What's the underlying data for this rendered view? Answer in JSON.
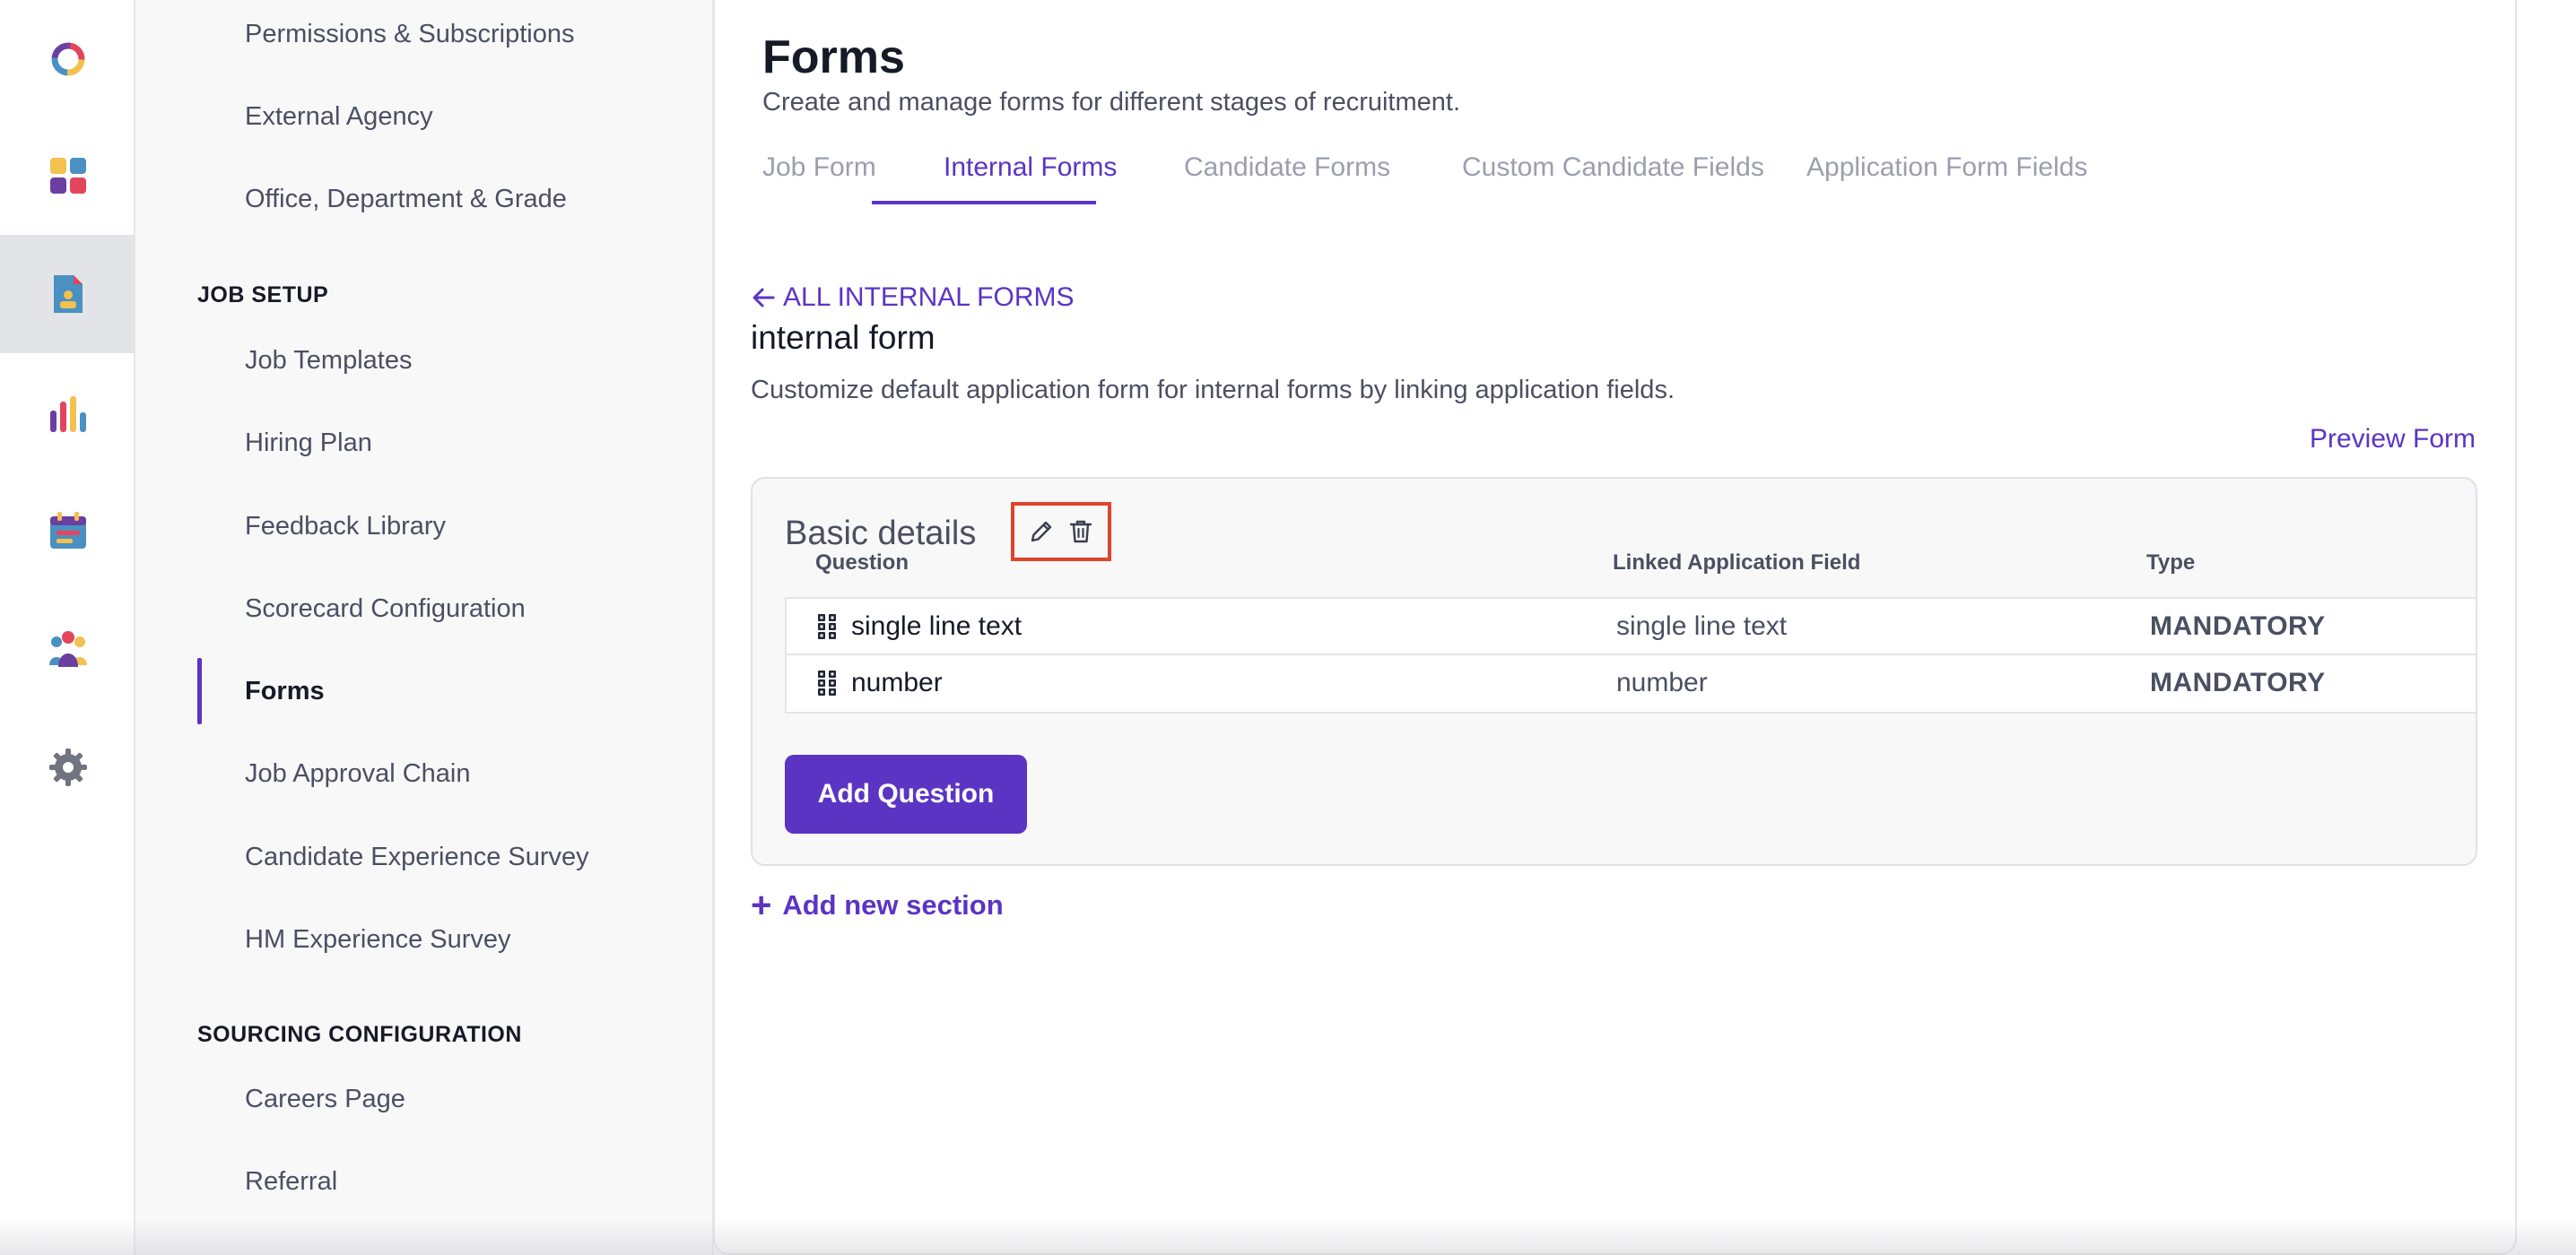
{
  "rail": {
    "items": [
      {
        "icon": "app-logo-icon"
      },
      {
        "icon": "dashboard-icon"
      },
      {
        "icon": "jobs-document-icon"
      },
      {
        "icon": "analytics-chart-icon"
      },
      {
        "icon": "calendar-icon"
      },
      {
        "icon": "people-icon"
      },
      {
        "icon": "gear-icon"
      }
    ],
    "active": "jobs-document-icon",
    "colors": {
      "active_bg": "#e3e4e8",
      "red": "#e3455d",
      "yellow": "#f2c14e",
      "blue": "#4a90c2",
      "purple": "#6a3fa0"
    }
  },
  "settings_nav": {
    "top_items": [
      "Permissions & Subscriptions",
      "External Agency",
      "Office, Department & Grade"
    ],
    "job_setup_heading": "JOB SETUP",
    "job_setup_items": [
      "Job Templates",
      "Hiring Plan",
      "Feedback Library",
      "Scorecard Configuration",
      "Forms",
      "Job Approval Chain",
      "Candidate Experience Survey",
      "HM Experience Survey"
    ],
    "active_item": "Forms",
    "sourcing_heading": "SOURCING CONFIGURATION",
    "sourcing_items": [
      "Careers Page",
      "Referral"
    ]
  },
  "main": {
    "title": "Forms",
    "subtitle": "Create and manage forms for different stages of recruitment.",
    "tabs": [
      {
        "label": "Job Form",
        "active": false
      },
      {
        "label": "Internal Forms",
        "active": true
      },
      {
        "label": "Candidate Forms",
        "active": false
      },
      {
        "label": "Custom Candidate Fields",
        "active": false
      },
      {
        "label": "Application Form Fields",
        "active": false
      }
    ],
    "back_link": "ALL INTERNAL FORMS",
    "form_name": "internal form",
    "form_description": "Customize default application form for internal forms by linking application fields.",
    "preview_link": "Preview Form",
    "section": {
      "title": "Basic details",
      "columns": {
        "question": "Question",
        "linked_field": "Linked Application Field",
        "type": "Type"
      },
      "rows": [
        {
          "question": "single line text",
          "linked_field": "single line text",
          "type": "MANDATORY"
        },
        {
          "question": "number",
          "linked_field": "number",
          "type": "MANDATORY"
        }
      ],
      "add_question": "Add Question"
    },
    "add_section": "Add new section",
    "accent_color": "#5b34c4",
    "highlight_color": "#e0432c"
  }
}
